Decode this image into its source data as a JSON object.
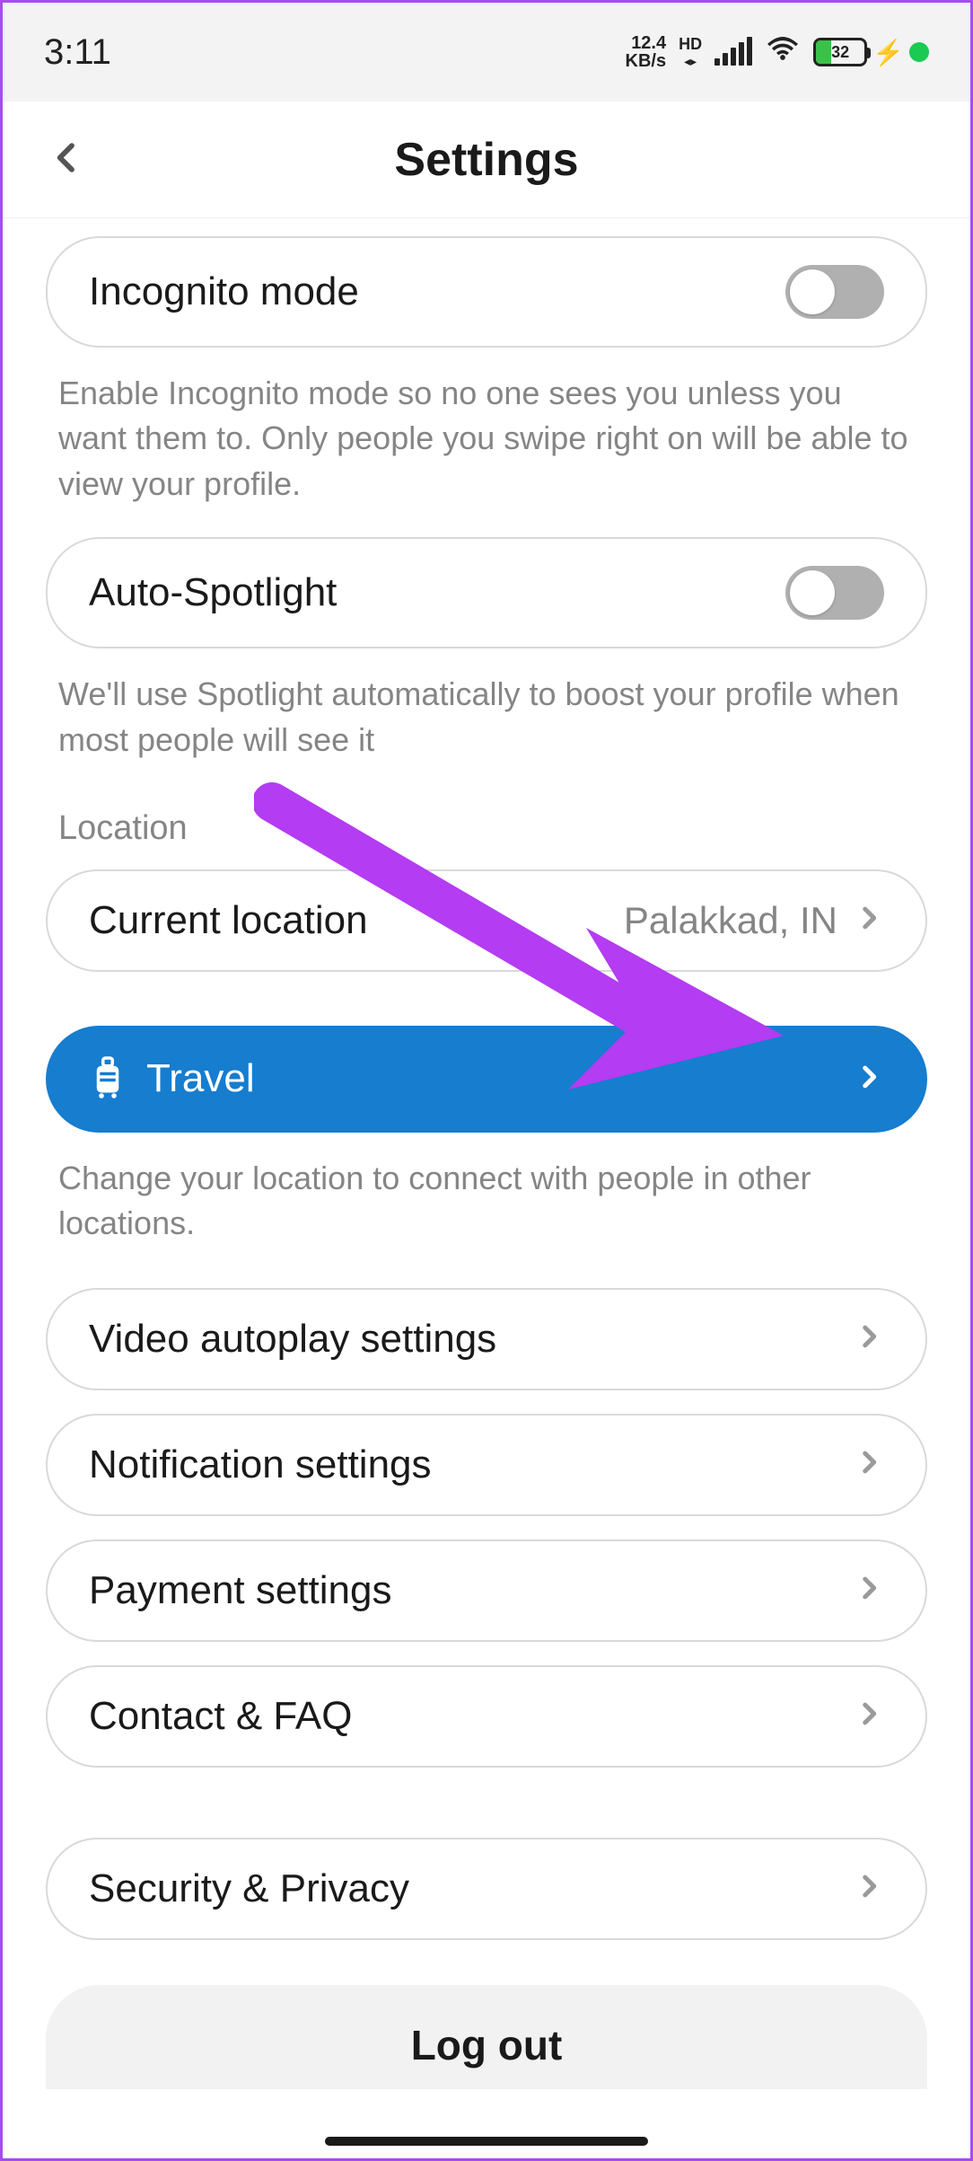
{
  "statusbar": {
    "time": "3:11",
    "net_speed_top": "12.4",
    "net_speed_bottom": "KB/s",
    "hd": "HD",
    "battery_percent": "32",
    "battery_fill_width": "32%"
  },
  "header": {
    "title": "Settings"
  },
  "items": {
    "incognito": {
      "label": "Incognito mode",
      "desc": "Enable Incognito mode so no one sees you unless you want them to. Only people you swipe right on will be able to view your profile."
    },
    "autospotlight": {
      "label": "Auto-Spotlight",
      "desc": "We'll use Spotlight automatically to boost your profile when most people will see it"
    },
    "location_section": "Location",
    "current_location": {
      "label": "Current location",
      "value": "Palakkad, IN"
    },
    "travel": {
      "label": "Travel",
      "desc": "Change your location to connect with people in other locations."
    },
    "video": {
      "label": "Video autoplay settings"
    },
    "notification": {
      "label": "Notification settings"
    },
    "payment": {
      "label": "Payment settings"
    },
    "contact": {
      "label": "Contact & FAQ"
    },
    "security": {
      "label": "Security & Privacy"
    },
    "logout": {
      "label": "Log out"
    }
  },
  "colors": {
    "accent_blue": "#167dcf",
    "arrow_purple": "#b43cf2"
  }
}
